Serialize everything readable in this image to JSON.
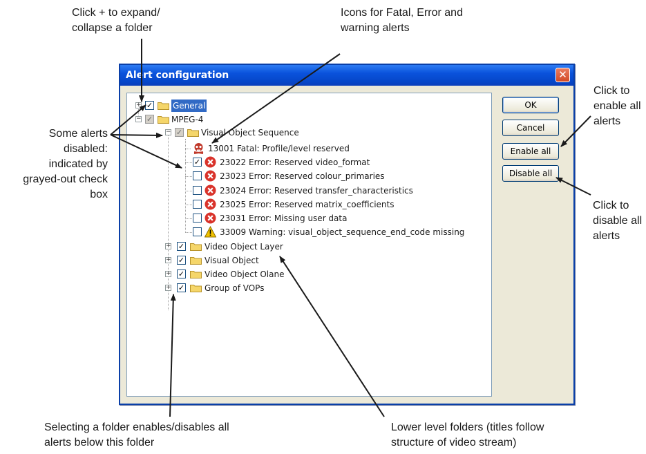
{
  "dialog": {
    "title": "Alert configuration",
    "close_glyph": "✕",
    "buttons": {
      "ok": "OK",
      "cancel": "Cancel",
      "enable_all": "Enable all",
      "disable_all": "Disable all"
    },
    "tree": {
      "general": "General",
      "mpeg4": "MPEG-4",
      "visual_object_sequence": "Visual Object Sequence",
      "alerts": [
        {
          "text": "13001 Fatal: Profile/level reserved",
          "level": "fatal",
          "checked": null
        },
        {
          "text": "23022 Error: Reserved video_format",
          "level": "error",
          "checked": true
        },
        {
          "text": "23023 Error: Reserved colour_primaries",
          "level": "error",
          "checked": false
        },
        {
          "text": "23024 Error: Reserved transfer_characteristics",
          "level": "error",
          "checked": false
        },
        {
          "text": "23025 Error: Reserved matrix_coefficients",
          "level": "error",
          "checked": false
        },
        {
          "text": "23031 Error: Missing user data",
          "level": "error",
          "checked": false
        },
        {
          "text": "33009 Warning: visual_object_sequence_end_code missing",
          "level": "warning",
          "checked": false
        }
      ],
      "folders": [
        "Video Object Layer",
        "Visual Object",
        "Video Object Olane",
        "Group of VOPs"
      ]
    }
  },
  "callouts": {
    "expand": [
      "Click + to expand/",
      "collapse a folder"
    ],
    "icons": [
      "Icons for Fatal, Error and",
      "warning alerts"
    ],
    "disabled": [
      "Some alerts",
      "disabled:",
      "indicated by",
      "grayed-out  check",
      "box"
    ],
    "enable": [
      "Click to",
      "enable all",
      "alerts"
    ],
    "disable": [
      "Click to",
      "disable all",
      "alerts"
    ],
    "folder_select": [
      "Selecting a folder enables/disables all",
      "alerts below this folder"
    ],
    "lower": [
      "Lower level folders (titles follow",
      "structure of video stream)"
    ]
  },
  "colors": {
    "title_bar": "#0a52dc",
    "selection": "#316ac5",
    "fatal": "#c0392b",
    "error": "#d9332b",
    "warning": "#f2c200",
    "folder": "#f5d66a"
  },
  "icons": {
    "fatal": "skull-icon",
    "error": "error-x-icon",
    "warning": "warning-triangle-icon",
    "folder": "folder-icon",
    "expander": "plus-minus-icon"
  }
}
